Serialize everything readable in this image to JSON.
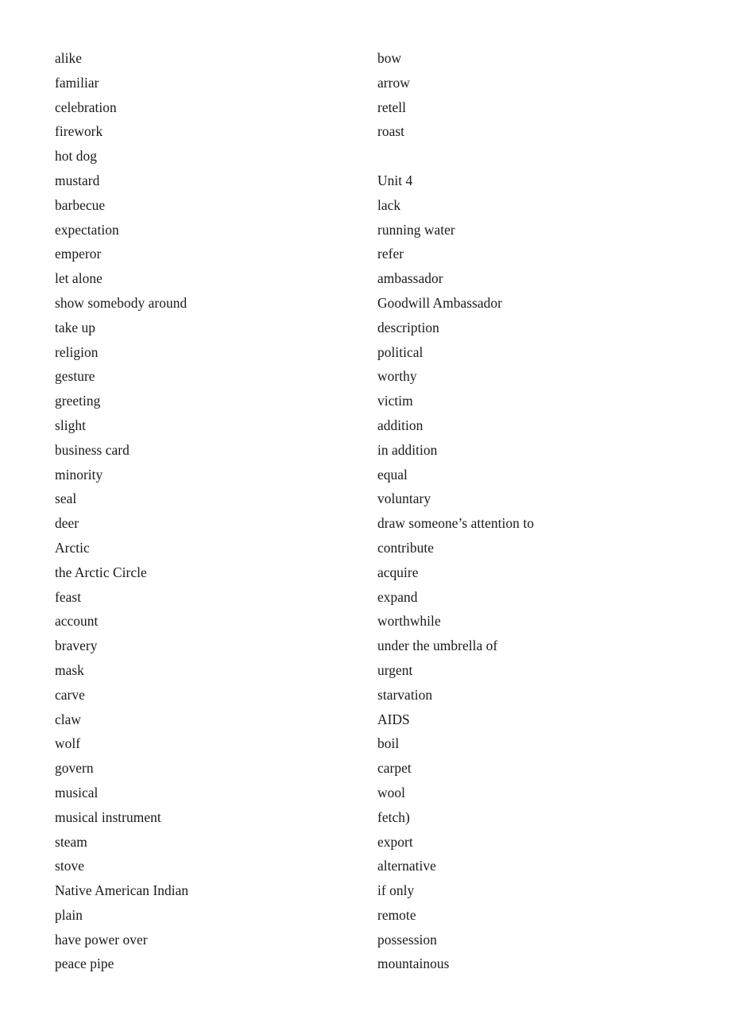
{
  "document": {
    "type": "vocabulary-word-list",
    "page_background": "#ffffff",
    "text_color": "#1a1a1a",
    "columns": 2
  },
  "left_column": {
    "name": "left-word-column",
    "lines": [
      {
        "text": "alike",
        "kind": "word"
      },
      {
        "text": "familiar",
        "kind": "word"
      },
      {
        "text": "celebration",
        "kind": "word"
      },
      {
        "text": "firework",
        "kind": "word"
      },
      {
        "text": "hot dog",
        "kind": "word"
      },
      {
        "text": "mustard",
        "kind": "word"
      },
      {
        "text": "barbecue",
        "kind": "word"
      },
      {
        "text": "expectation",
        "kind": "word"
      },
      {
        "text": "emperor",
        "kind": "word"
      },
      {
        "text": "let alone",
        "kind": "word"
      },
      {
        "text": "show somebody around",
        "kind": "word"
      },
      {
        "text": "take up",
        "kind": "word"
      },
      {
        "text": "religion",
        "kind": "word"
      },
      {
        "text": "gesture",
        "kind": "word"
      },
      {
        "text": "greeting",
        "kind": "word"
      },
      {
        "text": "slight",
        "kind": "word"
      },
      {
        "text": "business card",
        "kind": "word"
      },
      {
        "text": "minority",
        "kind": "word"
      },
      {
        "text": "seal",
        "kind": "word"
      },
      {
        "text": "deer",
        "kind": "word"
      },
      {
        "text": "Arctic",
        "kind": "word"
      },
      {
        "text": "the Arctic Circle",
        "kind": "word"
      },
      {
        "text": "feast",
        "kind": "word"
      },
      {
        "text": "account",
        "kind": "word"
      },
      {
        "text": "bravery",
        "kind": "word"
      },
      {
        "text": "mask",
        "kind": "word"
      },
      {
        "text": "carve",
        "kind": "word"
      },
      {
        "text": "claw",
        "kind": "word"
      },
      {
        "text": "wolf",
        "kind": "word"
      },
      {
        "text": "govern",
        "kind": "word"
      },
      {
        "text": "musical",
        "kind": "word"
      },
      {
        "text": "musical instrument",
        "kind": "word"
      },
      {
        "text": "steam",
        "kind": "word"
      },
      {
        "text": "stove",
        "kind": "word"
      },
      {
        "text": "Native American Indian",
        "kind": "word"
      },
      {
        "text": "plain",
        "kind": "word"
      },
      {
        "text": "have power over",
        "kind": "word"
      },
      {
        "text": "peace pipe",
        "kind": "word"
      }
    ]
  },
  "right_column": {
    "name": "right-word-column",
    "lines": [
      {
        "text": "bow",
        "kind": "word"
      },
      {
        "text": "arrow",
        "kind": "word"
      },
      {
        "text": "retell",
        "kind": "word"
      },
      {
        "text": "roast",
        "kind": "word"
      },
      {
        "text": "",
        "kind": "spacer"
      },
      {
        "text": "Unit 4",
        "kind": "heading"
      },
      {
        "text": "lack",
        "kind": "word"
      },
      {
        "text": "running water",
        "kind": "word"
      },
      {
        "text": "refer",
        "kind": "word"
      },
      {
        "text": "ambassador",
        "kind": "word"
      },
      {
        "text": "Goodwill Ambassador",
        "kind": "word"
      },
      {
        "text": "description",
        "kind": "word"
      },
      {
        "text": "political",
        "kind": "word"
      },
      {
        "text": "worthy",
        "kind": "word"
      },
      {
        "text": "victim",
        "kind": "word"
      },
      {
        "text": "addition",
        "kind": "word"
      },
      {
        "text": "in addition",
        "kind": "word"
      },
      {
        "text": "equal",
        "kind": "word"
      },
      {
        "text": "voluntary",
        "kind": "word"
      },
      {
        "text": "draw someone’s attention to",
        "kind": "word"
      },
      {
        "text": "contribute",
        "kind": "word"
      },
      {
        "text": "acquire",
        "kind": "word"
      },
      {
        "text": "expand",
        "kind": "word"
      },
      {
        "text": "worthwhile",
        "kind": "word"
      },
      {
        "text": "under the umbrella of",
        "kind": "word"
      },
      {
        "text": "urgent",
        "kind": "word"
      },
      {
        "text": "starvation",
        "kind": "word"
      },
      {
        "text": "AIDS",
        "kind": "word"
      },
      {
        "text": "boil",
        "kind": "word"
      },
      {
        "text": "carpet",
        "kind": "word"
      },
      {
        "text": "wool",
        "kind": "word"
      },
      {
        "text": "fetch)",
        "kind": "word"
      },
      {
        "text": "export",
        "kind": "word"
      },
      {
        "text": "alternative",
        "kind": "word"
      },
      {
        "text": "if only",
        "kind": "word"
      },
      {
        "text": "remote",
        "kind": "word"
      },
      {
        "text": "possession",
        "kind": "word"
      },
      {
        "text": "mountainous",
        "kind": "word"
      }
    ]
  }
}
